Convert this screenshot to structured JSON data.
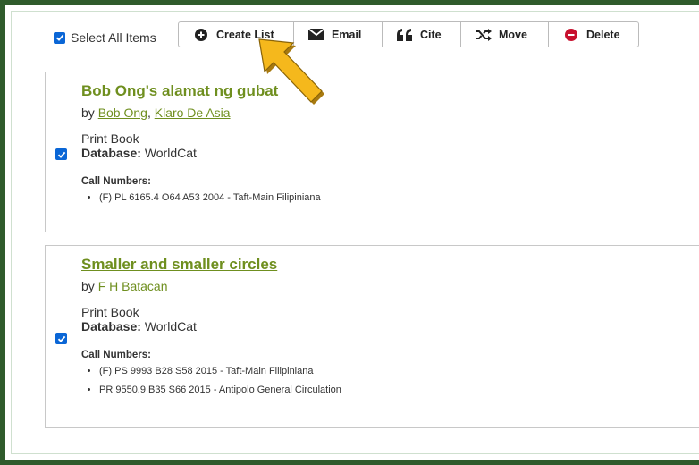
{
  "select_all": {
    "label": "Select All Items",
    "checked": true
  },
  "toolbar": {
    "buttons": [
      {
        "label": "Create List",
        "icon": "plus-circle-icon"
      },
      {
        "label": "Email",
        "icon": "envelope-icon"
      },
      {
        "label": "Cite",
        "icon": "quote-icon"
      },
      {
        "label": "Move",
        "icon": "shuffle-icon"
      },
      {
        "label": "Delete",
        "icon": "minus-circle-icon"
      }
    ]
  },
  "records": [
    {
      "checked": true,
      "title": "Bob Ong's alamat ng gubat",
      "by_prefix": "by",
      "authors": [
        "Bob Ong",
        "Klaro De Asia"
      ],
      "format": "Print Book",
      "database_label": "Database:",
      "database_value": "WorldCat",
      "call_numbers_label": "Call Numbers:",
      "call_numbers": [
        "(F) PL 6165.4 O64 A53 2004 - Taft-Main Filipiniana"
      ]
    },
    {
      "checked": true,
      "title": "Smaller and smaller circles",
      "by_prefix": "by",
      "authors": [
        "F H Batacan"
      ],
      "format": "Print Book",
      "database_label": "Database:",
      "database_value": "WorldCat",
      "call_numbers_label": "Call Numbers:",
      "call_numbers": [
        "(F) PS 9993 B28 S58 2015 - Taft-Main Filipiniana",
        "PR 9550.9 B35 S66 2015 - Antipolo General Circulation"
      ]
    }
  ],
  "colors": {
    "frame": "#2f5b2c",
    "link": "#6f8f1f",
    "arrow_fill": "#f5b81c",
    "checkbox": "#0a66d6",
    "delete_icon": "#c8102e"
  }
}
